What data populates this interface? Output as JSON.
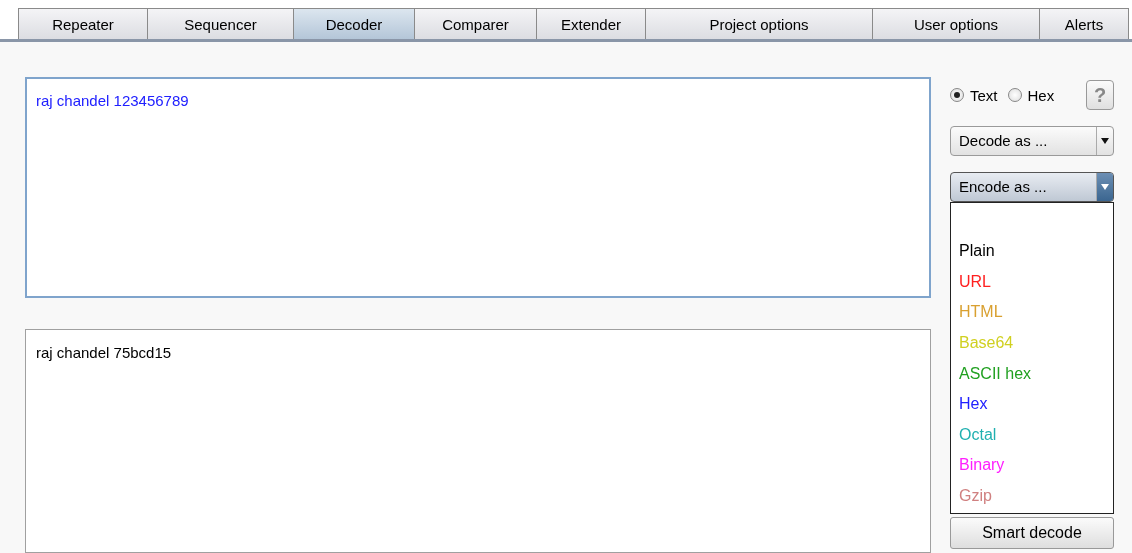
{
  "tabs": [
    {
      "label": "Repeater",
      "selected": false
    },
    {
      "label": "Sequencer",
      "selected": false
    },
    {
      "label": "Decoder",
      "selected": true
    },
    {
      "label": "Comparer",
      "selected": false
    },
    {
      "label": "Extender",
      "selected": false
    },
    {
      "label": "Project options",
      "selected": false
    },
    {
      "label": "User options",
      "selected": false
    },
    {
      "label": "Alerts",
      "selected": false
    }
  ],
  "editors": [
    {
      "text": "raj chandel 123456789",
      "color": "#2020ff",
      "focused": true
    },
    {
      "text": "raj chandel 75bcd15",
      "color": "#000000",
      "focused": false
    }
  ],
  "mode_options": [
    {
      "label": "Text",
      "selected": true
    },
    {
      "label": "Hex",
      "selected": false
    }
  ],
  "help_button": {
    "label": "?"
  },
  "decode_dropdown": {
    "value": "Decode as ...",
    "open": false
  },
  "encode_dropdown": {
    "value": "Encode as ...",
    "open": true,
    "options": [
      {
        "label": "Plain",
        "color": "#000000"
      },
      {
        "label": "URL",
        "color": "#ff2020"
      },
      {
        "label": "HTML",
        "color": "#d9a030"
      },
      {
        "label": "Base64",
        "color": "#d0d020"
      },
      {
        "label": "ASCII hex",
        "color": "#20a020"
      },
      {
        "label": "Hex",
        "color": "#2020ff"
      },
      {
        "label": "Octal",
        "color": "#20b0b0"
      },
      {
        "label": "Binary",
        "color": "#ff20ff"
      },
      {
        "label": "Gzip",
        "color": "#d08080"
      }
    ]
  },
  "smart_decode_button": {
    "label": "Smart decode"
  }
}
